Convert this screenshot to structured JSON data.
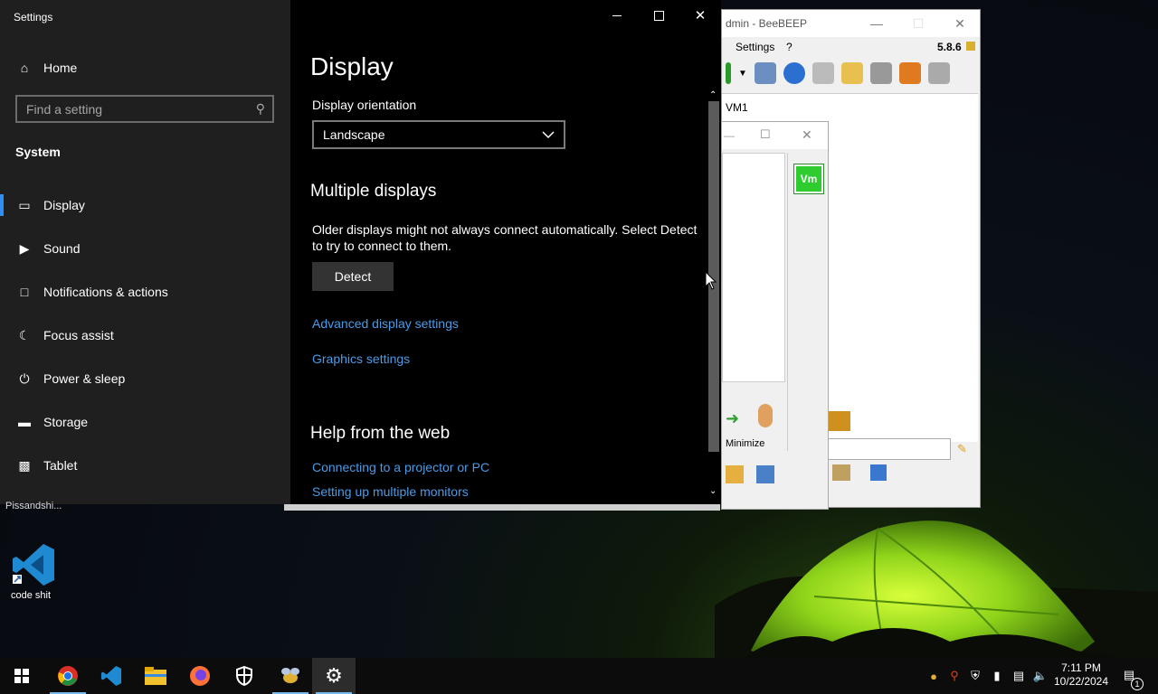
{
  "settings": {
    "app_title": "Settings",
    "home_label": "Home",
    "search_placeholder": "Find a setting",
    "section_label": "System",
    "nav_items": [
      {
        "label": "Display",
        "icon": "monitor-icon"
      },
      {
        "label": "Sound",
        "icon": "speaker-icon"
      },
      {
        "label": "Notifications & actions",
        "icon": "notification-icon"
      },
      {
        "label": "Focus assist",
        "icon": "moon-icon"
      },
      {
        "label": "Power & sleep",
        "icon": "power-icon"
      },
      {
        "label": "Storage",
        "icon": "storage-icon"
      },
      {
        "label": "Tablet",
        "icon": "tablet-icon"
      }
    ],
    "page_title": "Display",
    "orientation_label": "Display orientation",
    "orientation_value": "Landscape",
    "multiple_displays_heading": "Multiple displays",
    "multiple_displays_desc": "Older displays might not always connect automatically. Select Detect to try to connect to them.",
    "detect_button": "Detect",
    "advanced_link": "Advanced display settings",
    "graphics_link": "Graphics settings",
    "help_heading": "Help from the web",
    "help_links": [
      "Connecting to a projector or PC",
      "Setting up multiple monitors"
    ],
    "accent_color": "#2f8df5"
  },
  "beebeep": {
    "title": "dmin - BeeBEEP",
    "menu_settings": "Settings",
    "menu_help": "?",
    "version": "5.8.6",
    "user_label": "VM1",
    "vm_badge": "Vm",
    "minimize_label": "Minimize"
  },
  "desktop": {
    "truncated_label": "Pissandshi...",
    "vscode_label": "code shit"
  },
  "taskbar": {
    "time": "7:11 PM",
    "date": "10/22/2024",
    "notification_count": "1"
  }
}
